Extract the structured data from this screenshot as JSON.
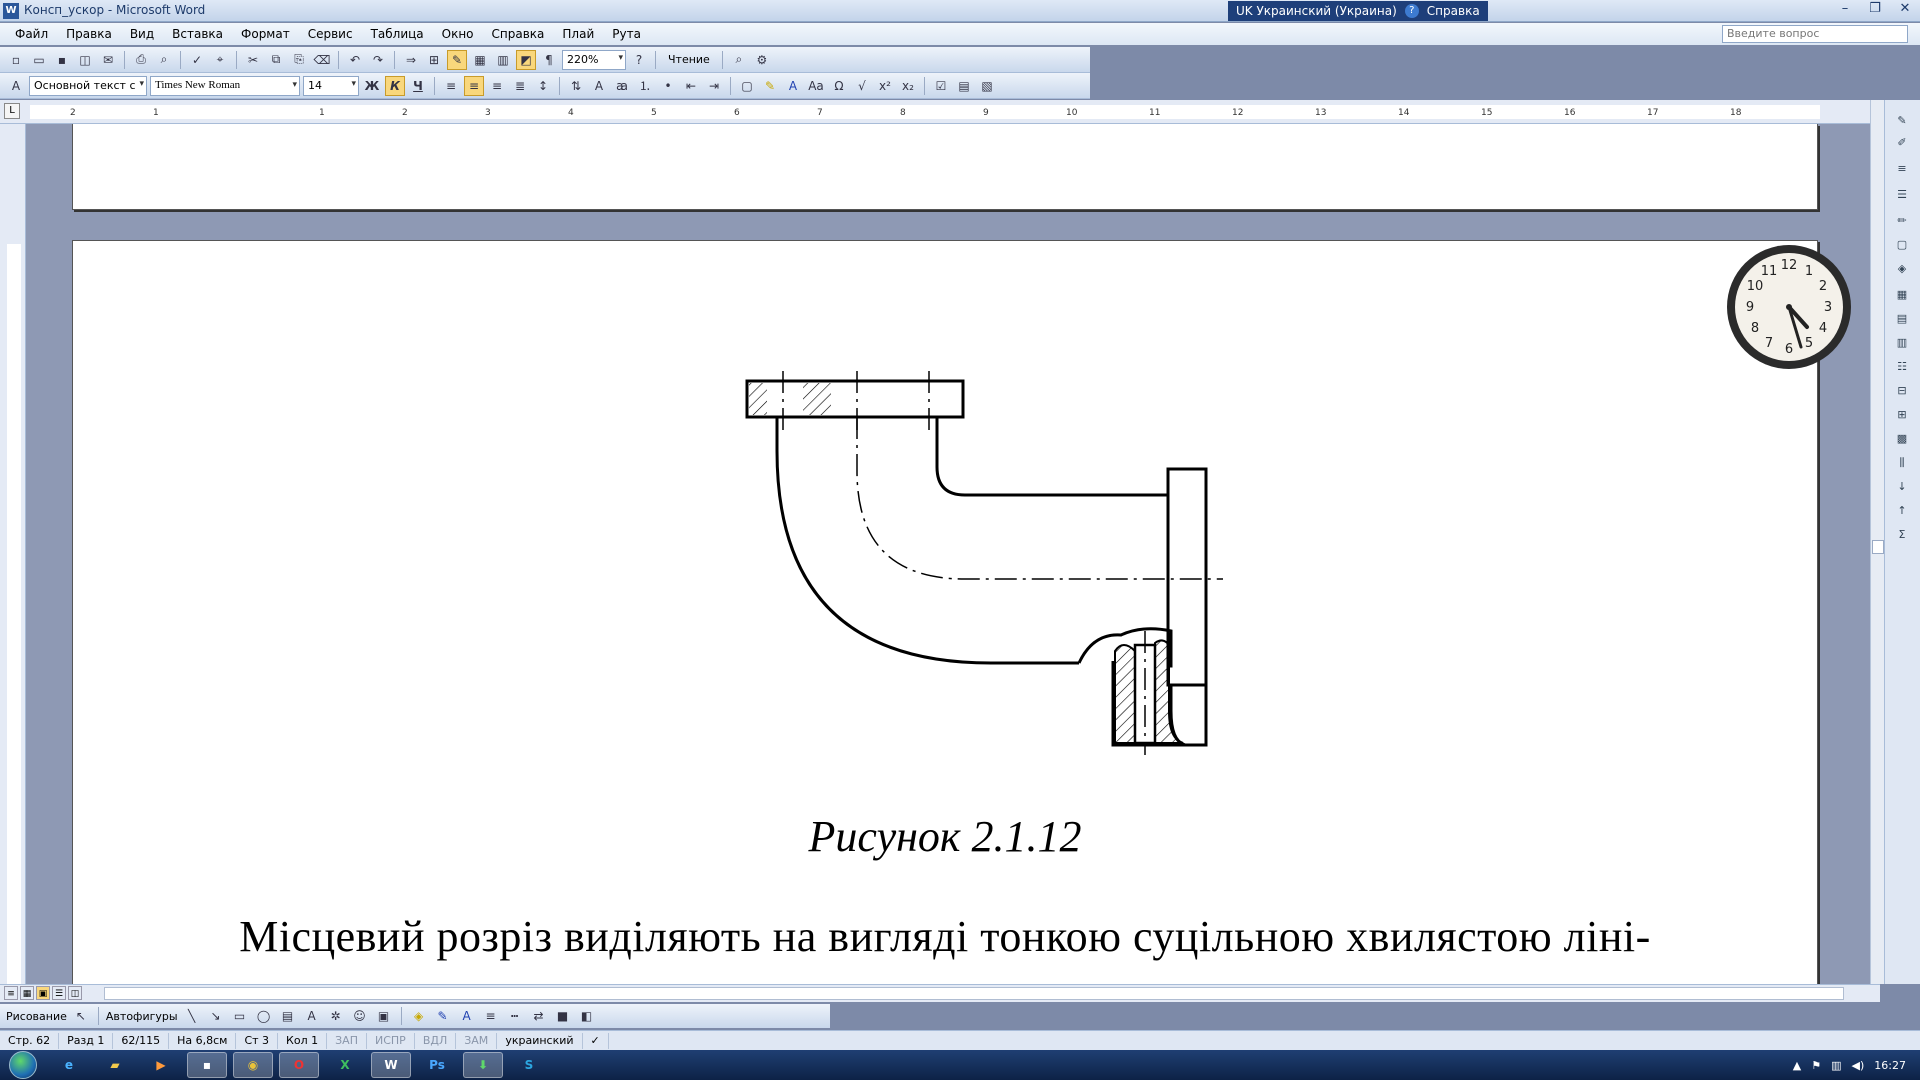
{
  "window": {
    "title": "Консп_ускор - Microsoft Word",
    "app_icon": "W"
  },
  "langbar": {
    "language": "UK Украинский (Украина)",
    "help": "Справка"
  },
  "menu": [
    "Файл",
    "Правка",
    "Вид",
    "Вставка",
    "Формат",
    "Сервис",
    "Таблица",
    "Окно",
    "Справка",
    "Плай",
    "Рута"
  ],
  "ask_placeholder": "Введите вопрос",
  "toolbar": {
    "zoom": "220%",
    "read_label": "Чтение",
    "style": "Основной текст с",
    "font": "Times New Roman",
    "size": "14",
    "bold": "Ж",
    "italic": "К",
    "underline": "Ч"
  },
  "ruler": {
    "numbers": [
      "2",
      "1",
      "1",
      "2",
      "3",
      "4",
      "5",
      "6",
      "7",
      "8",
      "9",
      "10",
      "11",
      "12",
      "13",
      "14",
      "15",
      "16",
      "17",
      "18"
    ]
  },
  "document": {
    "caption": "Рисунок 2.1.12",
    "body_line": "Місцевий розріз виділяють на вигляді тонкою суцільною хвилястою ліні-"
  },
  "clock": {
    "numbers": [
      "12",
      "1",
      "2",
      "3",
      "4",
      "5",
      "6",
      "7",
      "8",
      "9",
      "10",
      "11"
    ]
  },
  "drawing_toolbar": {
    "draw_label": "Рисование",
    "autoshapes_label": "Автофигуры"
  },
  "status": {
    "page": "Стр. 62",
    "section": "Разд 1",
    "pages": "62/115",
    "at": "На 6,8см",
    "line": "Ст 3",
    "col": "Кол 1",
    "rec": "ЗАП",
    "trk": "ИСПР",
    "ext": "ВДЛ",
    "ovr": "ЗАМ",
    "lang": "украинский"
  },
  "taskbar": {
    "time": "16:27",
    "word_label": "W",
    "ps_label": "Ps",
    "skype_label": "S"
  }
}
